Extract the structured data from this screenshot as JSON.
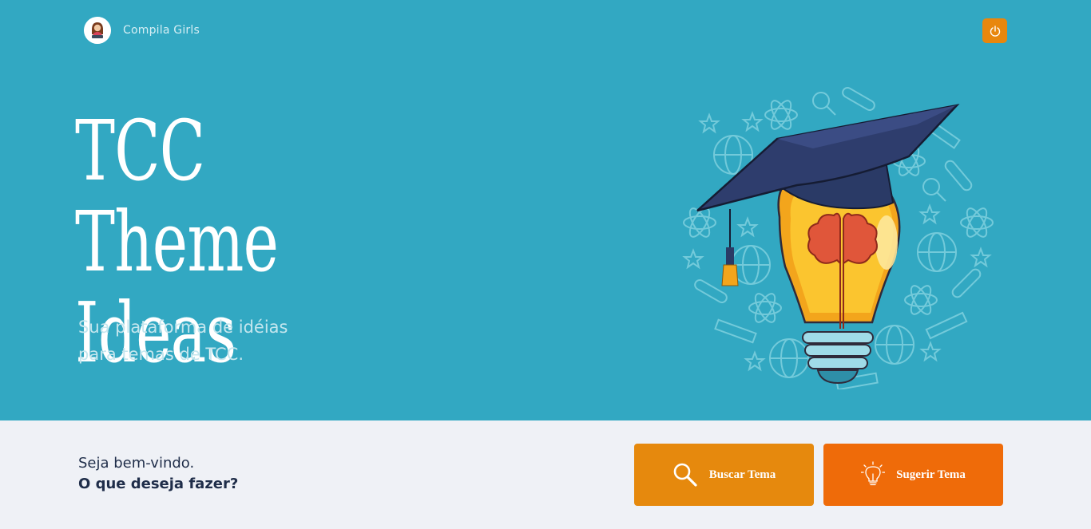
{
  "brand": {
    "name": "Compila Girls",
    "logo_icon": "compila-girls-avatar-icon"
  },
  "header": {
    "power_icon": "power-icon"
  },
  "hero": {
    "title_line1": "TCC Theme",
    "title_line2": "Ideas",
    "subtitle_line1": "Sua plataforma de idéias",
    "subtitle_line2": "para temas de TCC.",
    "illustration": "graduation-cap-lightbulb-brain-illustration"
  },
  "welcome": {
    "line1": "Seja bem-vindo.",
    "line2": "O que deseja fazer?"
  },
  "actions": {
    "search": {
      "label": "Buscar Tema",
      "icon": "search-icon"
    },
    "suggest": {
      "label": "Sugerir Tema",
      "icon": "lightbulb-icon"
    }
  },
  "colors": {
    "hero_bg": "#32a8c2",
    "page_bg": "#eff1f6",
    "search_button": "#e6890d",
    "suggest_button": "#ef6b09",
    "power_button": "#e8870d",
    "text_dark": "#1f2d49"
  }
}
